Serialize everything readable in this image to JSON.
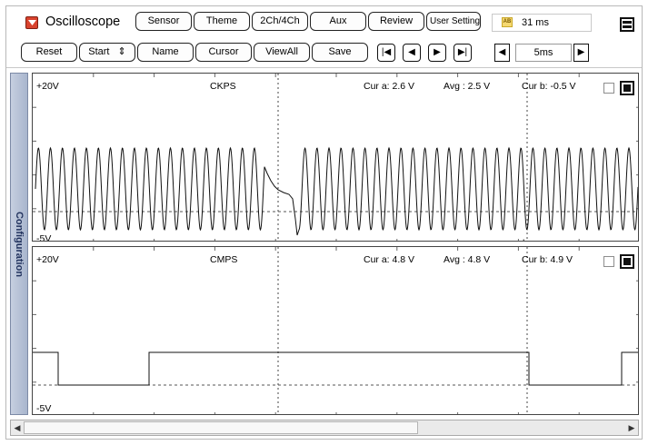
{
  "app": {
    "title": "Oscilloscope"
  },
  "top_menu": {
    "sensor": "Sensor",
    "theme": "Theme",
    "channels": "2Ch/4Ch",
    "aux": "Aux",
    "review": "Review",
    "user_setting": "User Setting"
  },
  "hint": {
    "icon_text": "AB",
    "value": "31 ms"
  },
  "toolbar": {
    "reset": "Reset",
    "start": "Start",
    "start_spinner": "⇕",
    "name": "Name",
    "cursor": "Cursor",
    "view_all": "ViewAll",
    "save": "Save",
    "first": "|◀",
    "prev": "◀",
    "next": "▶",
    "last": "▶|",
    "time_dec": "◀",
    "time_inc": "▶",
    "time_div": "5ms"
  },
  "sidebar": {
    "configuration": "Configuration"
  },
  "channels": [
    {
      "name": "CKPS",
      "vmax": "+20V",
      "vmin": "-5V",
      "cur_a": "Cur a: 2.6 V",
      "avg": "Avg  : 2.5 V",
      "cur_b": "Cur b: -0.5 V",
      "marker_a": "a",
      "marker_b": "b"
    },
    {
      "name": "CMPS",
      "vmax": "+20V",
      "vmin": "-5V",
      "cur_a": "Cur a: 4.8 V",
      "avg": "Avg  : 4.8 V",
      "cur_b": "Cur b: 4.9 V"
    }
  ],
  "scroll": {
    "left": "◀",
    "right": "▶"
  },
  "colors": {
    "trace": "#111111",
    "grid": "#666666",
    "config_tab": "#a8b5cd"
  }
}
